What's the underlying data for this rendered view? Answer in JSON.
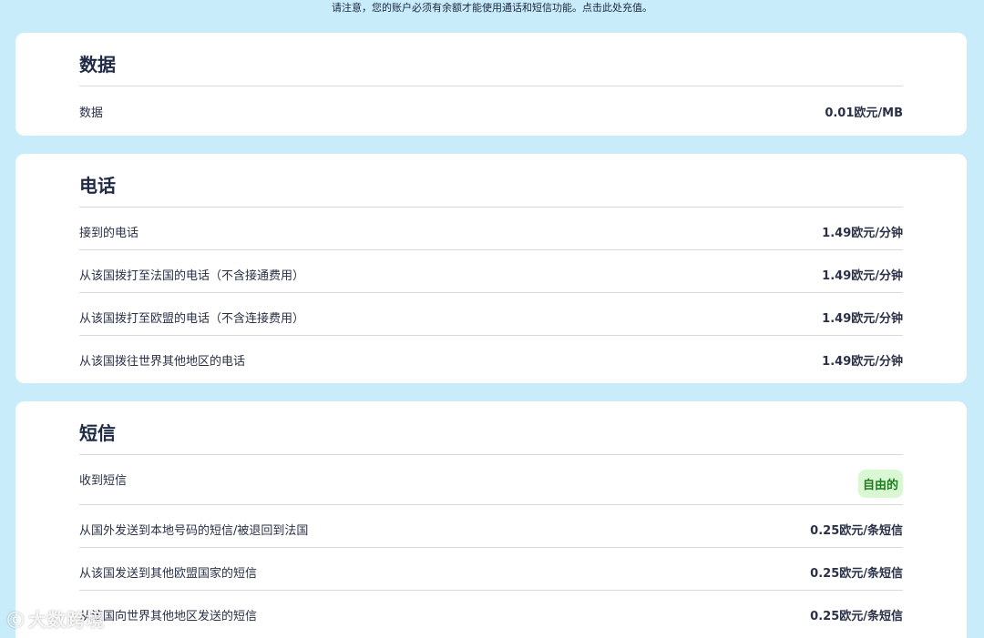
{
  "notice": "请注意，您的账户必须有余额才能使用通话和短信功能。点击此处充值。",
  "data_section": {
    "title": "数据",
    "rows": [
      {
        "label": "数据",
        "value": "0.01欧元/MB"
      }
    ]
  },
  "phone_section": {
    "title": "电话",
    "rows": [
      {
        "label": "接到的电话",
        "value": "1.49欧元/分钟"
      },
      {
        "label": "从该国拨打至法国的电话（不含接通费用）",
        "value": "1.49欧元/分钟"
      },
      {
        "label": "从该国拨打至欧盟的电话（不含连接费用）",
        "value": "1.49欧元/分钟"
      },
      {
        "label": "从该国拨往世界其他地区的电话",
        "value": "1.49欧元/分钟"
      }
    ]
  },
  "sms_section": {
    "title": "短信",
    "rows": [
      {
        "label": "收到短信",
        "value": "自由的"
      },
      {
        "label": "从国外发送到本地号码的短信/被退回到法国",
        "value": "0.25欧元/条短信"
      },
      {
        "label": "从该国发送到其他欧盟国家的短信",
        "value": "0.25欧元/条短信"
      },
      {
        "label": "从该国向世界其他地区发送的短信",
        "value": "0.25欧元/条短信"
      }
    ]
  },
  "watermark": "大数跨境",
  "colors": {
    "background": "#c9ecfb",
    "card": "#ffffff",
    "badge_bg": "#d9f7d2",
    "badge_text": "#1f7a1f"
  }
}
